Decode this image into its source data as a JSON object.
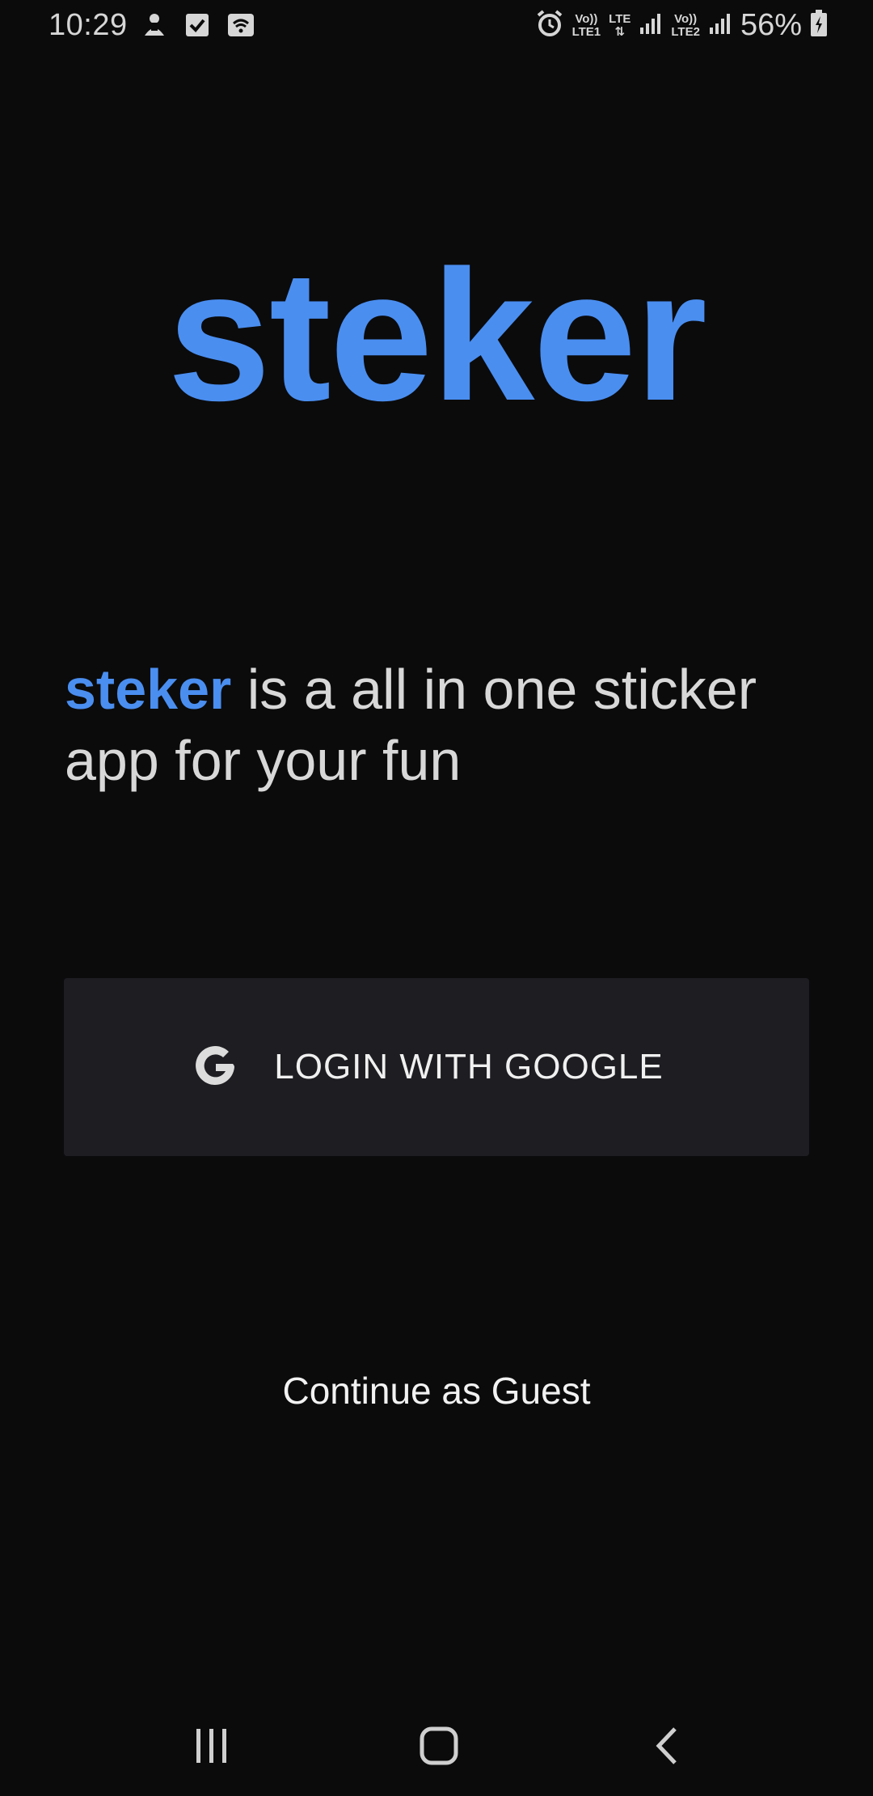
{
  "status_bar": {
    "time": "10:29",
    "net1_top": "Vo))",
    "net1_bottom": "LTE1",
    "lte": "LTE",
    "net2_top": "Vo))",
    "net2_bottom": "LTE2",
    "battery": "56%"
  },
  "logo": "steker",
  "tagline": {
    "brand": "steker",
    "text": " is a all in one sticker app for your fun"
  },
  "login": {
    "label": "LOGIN WITH GOOGLE"
  },
  "guest": {
    "label": "Continue as Guest"
  },
  "colors": {
    "background": "#0b0b0c",
    "accent": "#4a8ef0",
    "button_bg": "#1e1d22"
  },
  "icons": [
    "notification-icon",
    "check-icon",
    "wifi-icon",
    "alarm-icon",
    "signal-icon",
    "battery-icon",
    "google-icon",
    "recent-apps-icon",
    "home-icon",
    "back-icon"
  ]
}
